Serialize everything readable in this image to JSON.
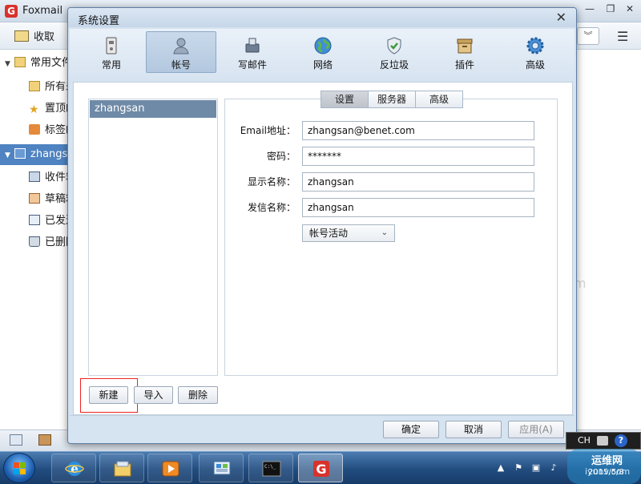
{
  "app": {
    "title": "Foxmail",
    "toolbar": {
      "receive_label": "收取"
    },
    "sidebar": [
      {
        "label": "常用文件",
        "kind": "folder",
        "expanded": true
      },
      {
        "label": "所有未",
        "kind": "folder"
      },
      {
        "label": "置顶邮",
        "kind": "star"
      },
      {
        "label": "标签邮",
        "kind": "tag"
      },
      {
        "label": "zhangsa",
        "kind": "account",
        "selected": true,
        "expanded": true
      },
      {
        "label": "收件箱",
        "kind": "inbox"
      },
      {
        "label": "草稿箱",
        "kind": "drafts"
      },
      {
        "label": "已发送",
        "kind": "sent"
      },
      {
        "label": "已删除",
        "kind": "trash"
      }
    ],
    "background_hint": "m"
  },
  "dialog": {
    "title": "系统设置",
    "nav": [
      {
        "label": "常用",
        "icon": "general-icon"
      },
      {
        "label": "帐号",
        "icon": "account-icon",
        "active": true
      },
      {
        "label": "写邮件",
        "icon": "compose-icon"
      },
      {
        "label": "网络",
        "icon": "network-icon"
      },
      {
        "label": "反垃圾",
        "icon": "antispam-icon"
      },
      {
        "label": "插件",
        "icon": "plugin-icon"
      },
      {
        "label": "高级",
        "icon": "advanced-icon"
      }
    ],
    "accounts": [
      "zhangsan"
    ],
    "account_buttons": {
      "new": "新建",
      "import": "导入",
      "delete": "删除"
    },
    "subtabs": [
      {
        "label": "设置",
        "active": true
      },
      {
        "label": "服务器"
      },
      {
        "label": "高级"
      }
    ],
    "form": {
      "email": {
        "label": "Email地址：",
        "value": "zhangsan@benet.com"
      },
      "password": {
        "label": "密码：",
        "value": "*******"
      },
      "display_name": {
        "label": "显示名称：",
        "value": "zhangsan"
      },
      "sender_name": {
        "label": "发信名称：",
        "value": "zhangsan"
      },
      "status_select": {
        "value": "帐号活动"
      }
    },
    "footer": {
      "ok": "确定",
      "cancel": "取消",
      "apply": "应用(A)"
    }
  },
  "taskbar": {
    "language": "CH",
    "clock_date": "2015/5/8",
    "watermark": {
      "name": "运维网",
      "url": "iyunv.com"
    }
  },
  "colors": {
    "accent": "#4f83c1",
    "highlight_box": "#e22222",
    "dialog_bg": "#d6e3f0",
    "taskbar": "#214c7f"
  }
}
